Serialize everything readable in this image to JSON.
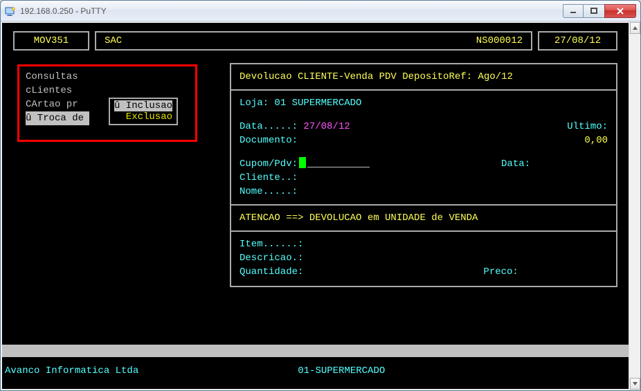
{
  "window": {
    "title": "192.168.0.250 - PuTTY"
  },
  "header": {
    "code": "MOV351",
    "app": "SAC",
    "session": "NS000012",
    "date": "27/08/12"
  },
  "menu": {
    "items": [
      "Consultas",
      "cLientes",
      "CArtao pr",
      "û Troca de"
    ],
    "selected_index": 3
  },
  "submenu": {
    "items": [
      "û Inclusao",
      "  Exclusao"
    ],
    "selected_index": 0
  },
  "form": {
    "title": "Devolucao CLIENTE-Venda PDV DepositoRef: Ago/12",
    "loja_label": "Loja:",
    "loja_value": "01 SUPERMERCADO",
    "data_label": "Data.....:",
    "data_value": "27/08/12",
    "ultimo_label": "Ultimo:",
    "documento_label": "Documento:",
    "documento_value": "0,00",
    "cupom_label": "Cupom/Pdv:",
    "cupom_data_label": "Data:",
    "cliente_label": "Cliente..:",
    "nome_label": "Nome.....:",
    "warn": "ATENCAO ==> DEVOLUCAO em UNIDADE de VENDA",
    "item_label": "Item......:",
    "descr_label": "Descricao.:",
    "qtd_label": "Quantidade:",
    "preco_label": "Preco:"
  },
  "footer": {
    "company": "Avanco Informatica Ltda",
    "location": "01-SUPERMERCADO"
  }
}
